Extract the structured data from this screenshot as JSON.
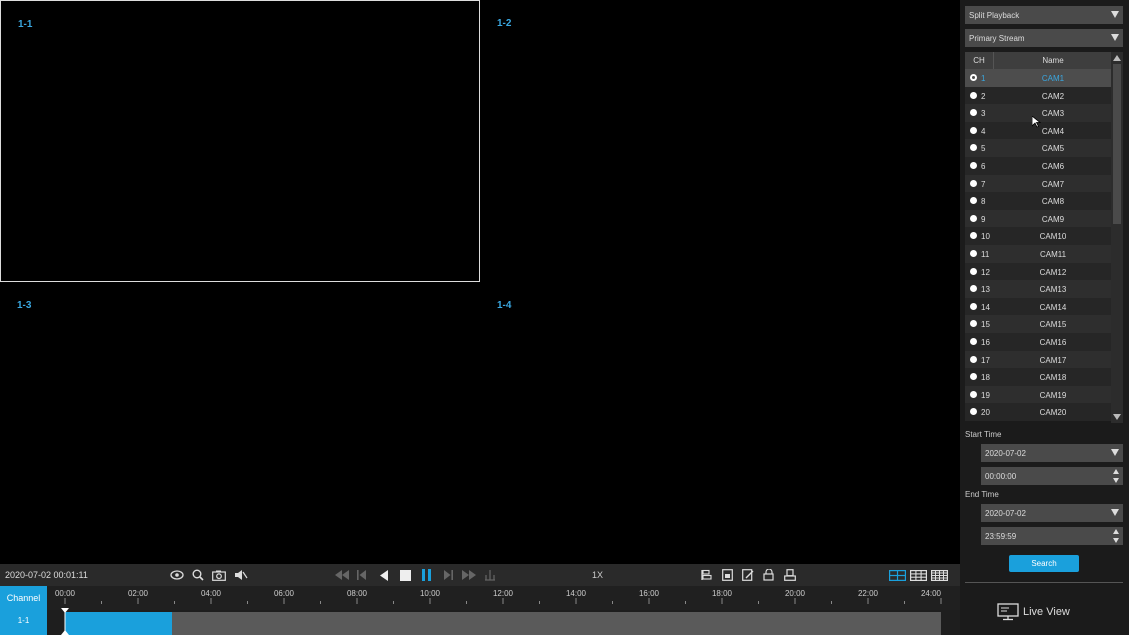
{
  "tiles": [
    {
      "label": "1-1"
    },
    {
      "label": "1-2"
    },
    {
      "label": "1-3"
    },
    {
      "label": "1-4"
    }
  ],
  "toolbar": {
    "timestamp": "2020-07-02 00:01:11",
    "speed": "1X"
  },
  "timeline": {
    "channel_header": "Channel",
    "channel_value": "1-1",
    "hours": [
      "00:00",
      "02:00",
      "04:00",
      "06:00",
      "08:00",
      "10:00",
      "12:00",
      "14:00",
      "16:00",
      "18:00",
      "20:00",
      "22:00",
      "24:00"
    ],
    "recorded_fraction": 0.122
  },
  "panel": {
    "mode_select": "Split Playback",
    "stream_select": "Primary Stream",
    "table_headers": {
      "ch": "CH",
      "name": "Name"
    },
    "channels": [
      {
        "ch": "1",
        "name": "CAM1"
      },
      {
        "ch": "2",
        "name": "CAM2"
      },
      {
        "ch": "3",
        "name": "CAM3"
      },
      {
        "ch": "4",
        "name": "CAM4"
      },
      {
        "ch": "5",
        "name": "CAM5"
      },
      {
        "ch": "6",
        "name": "CAM6"
      },
      {
        "ch": "7",
        "name": "CAM7"
      },
      {
        "ch": "8",
        "name": "CAM8"
      },
      {
        "ch": "9",
        "name": "CAM9"
      },
      {
        "ch": "10",
        "name": "CAM10"
      },
      {
        "ch": "11",
        "name": "CAM11"
      },
      {
        "ch": "12",
        "name": "CAM12"
      },
      {
        "ch": "13",
        "name": "CAM13"
      },
      {
        "ch": "14",
        "name": "CAM14"
      },
      {
        "ch": "15",
        "name": "CAM15"
      },
      {
        "ch": "16",
        "name": "CAM16"
      },
      {
        "ch": "17",
        "name": "CAM17"
      },
      {
        "ch": "18",
        "name": "CAM18"
      },
      {
        "ch": "19",
        "name": "CAM19"
      },
      {
        "ch": "20",
        "name": "CAM20"
      }
    ],
    "start_time_label": "Start Time",
    "start_date": "2020-07-02",
    "start_clock": "00:00:00",
    "end_time_label": "End Time",
    "end_date": "2020-07-02",
    "end_clock": "23:59:59",
    "search_label": "Search",
    "live_view_label": "Live View"
  },
  "colors": {
    "accent": "#1aa0dc",
    "panel_bg": "#1b1b1b"
  }
}
